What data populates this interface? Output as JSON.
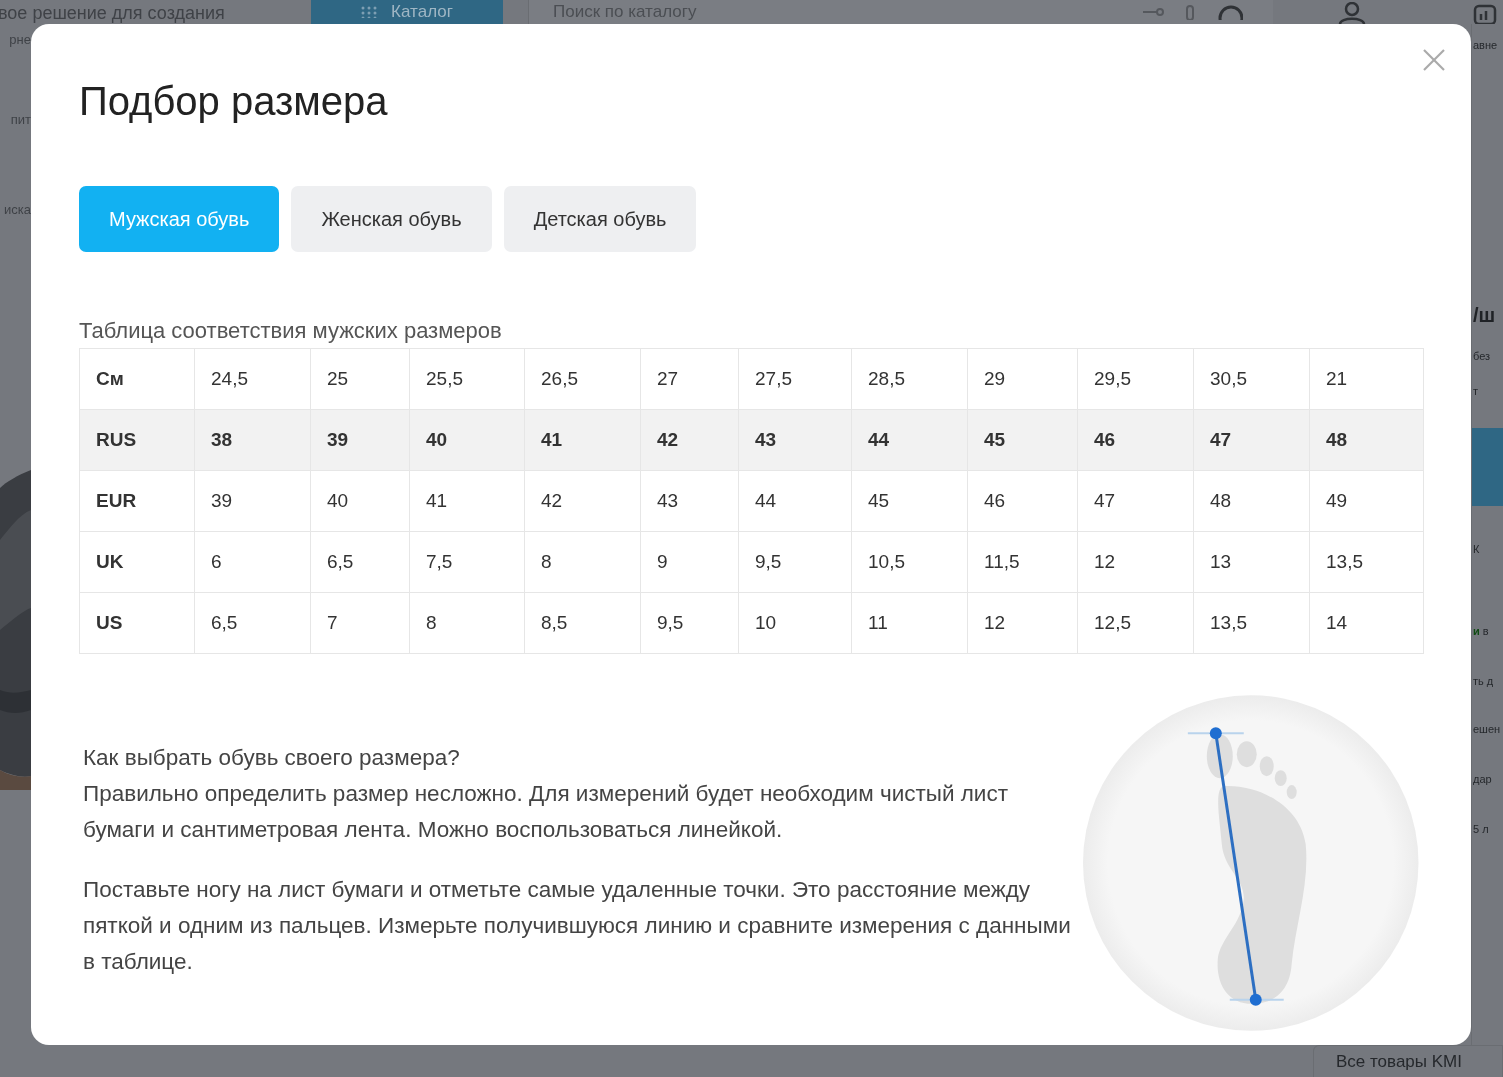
{
  "background_page": {
    "header_text": "вое решение для создания",
    "catalog_button": "Каталог",
    "search_placeholder": "Поиск по каталогу",
    "compare_label": "авне",
    "left_fragments": [
      "рне",
      "пит",
      "иска"
    ],
    "right_fragments": [
      {
        "kind": "heading",
        "text": "/ш"
      },
      {
        "kind": "muted",
        "text": "без"
      },
      {
        "kind": "muted",
        "text": "т"
      },
      {
        "kind": "button"
      },
      {
        "kind": "tab",
        "text": "К"
      },
      {
        "kind": "stock",
        "accent": "и",
        "text": "в"
      },
      {
        "kind": "line",
        "text": "ть д"
      },
      {
        "kind": "line",
        "text": "ешен"
      },
      {
        "kind": "line",
        "text": "дар"
      },
      {
        "kind": "line",
        "text": "5 л"
      }
    ],
    "all_products_button": "Все товары KMI"
  },
  "modal": {
    "title": "Подбор размера",
    "tabs": [
      {
        "label": "Мужская обувь",
        "selected": true
      },
      {
        "label": "Женская обувь",
        "selected": false
      },
      {
        "label": "Детская обувь",
        "selected": false
      }
    ],
    "table_caption": "Таблица соответствия мужских размеров",
    "table": {
      "rows": [
        {
          "label": "См",
          "highlighted": false,
          "values": [
            "24,5",
            "25",
            "25,5",
            "26,5",
            "27",
            "27,5",
            "28,5",
            "29",
            "29,5",
            "30,5",
            "21"
          ]
        },
        {
          "label": "RUS",
          "highlighted": true,
          "values": [
            "38",
            "39",
            "40",
            "41",
            "42",
            "43",
            "44",
            "45",
            "46",
            "47",
            "48"
          ]
        },
        {
          "label": "EUR",
          "highlighted": false,
          "values": [
            "39",
            "40",
            "41",
            "42",
            "43",
            "44",
            "45",
            "46",
            "47",
            "48",
            "49"
          ]
        },
        {
          "label": "UK",
          "highlighted": false,
          "values": [
            "6",
            "6,5",
            "7,5",
            "8",
            "9",
            "9,5",
            "10,5",
            "11,5",
            "12",
            "13",
            "13,5"
          ]
        },
        {
          "label": "US",
          "highlighted": false,
          "values": [
            "6,5",
            "7",
            "8",
            "8,5",
            "9,5",
            "10",
            "11",
            "12",
            "12,5",
            "13,5",
            "14"
          ]
        }
      ]
    },
    "help": {
      "question": "Как выбрать обувь своего размера?",
      "paragraphs": [
        "Правильно определить размер несложно. Для измерений будет необходим чистый лист бумаги и сантиметровая лента. Можно воспользоваться линейкой.",
        "Поставьте ногу на лист бумаги и отметьте самые удаленные точки. Это расстояние между пяткой и одним из пальцев. Измерьте получившуюся линию и сравните измерения с данными в таблице."
      ]
    }
  }
}
